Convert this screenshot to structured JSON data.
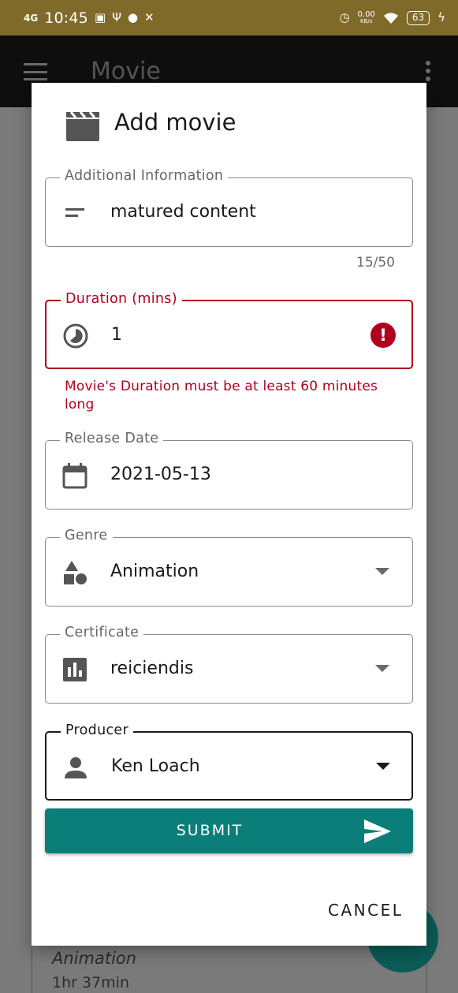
{
  "status_bar": {
    "network": "4G",
    "time": "10:45",
    "speed_value": "0.00",
    "speed_unit": "KB/s",
    "battery": "63"
  },
  "app_bar": {
    "title": "Movie"
  },
  "background": {
    "genre": "Animation",
    "duration": "1hr 37min"
  },
  "dialog": {
    "title": "Add movie",
    "additional_info": {
      "label": "Additional Information",
      "value": "matured content",
      "counter": "15/50",
      "icon": "notes-icon"
    },
    "duration": {
      "label": "Duration (mins)",
      "value": "1",
      "error": "Movie's Duration must be at least 60 minutes long",
      "icon": "timelapse-icon"
    },
    "release_date": {
      "label": "Release Date",
      "value": "2021-05-13",
      "icon": "calendar-icon"
    },
    "genre": {
      "label": "Genre",
      "value": "Animation",
      "icon": "category-icon"
    },
    "certificate": {
      "label": "Certificate",
      "value": "reiciendis",
      "icon": "bar-chart-icon"
    },
    "producer": {
      "label": "Producer",
      "value": "Ken Loach",
      "icon": "person-icon"
    },
    "submit_label": "SUBMIT",
    "cancel_label": "CANCEL"
  },
  "colors": {
    "status_bar": "#7f6a2a",
    "accent": "#0b7e7a",
    "error": "#b00020"
  }
}
